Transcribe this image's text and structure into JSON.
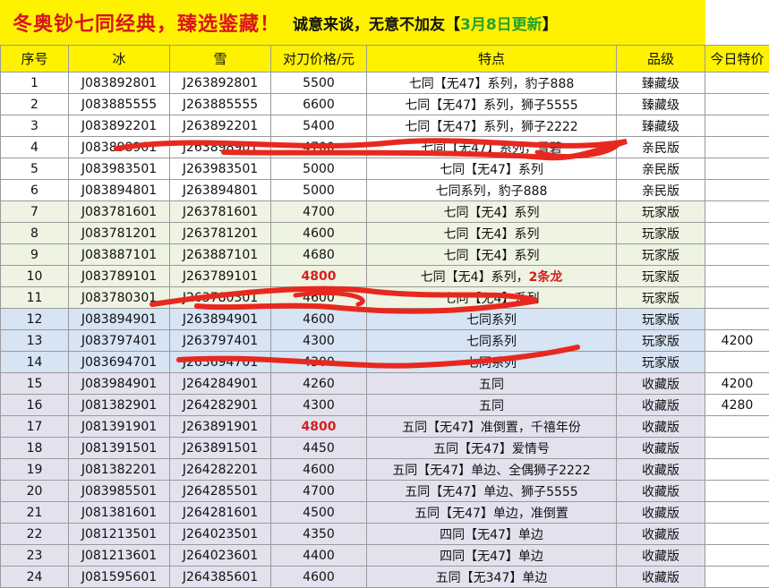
{
  "banner": {
    "title": "冬奥钞七同经典，臻选鉴藏！",
    "subtitle": "诚意来谈，无意不加友",
    "bracket_open": "【",
    "update": "3月8日更新",
    "bracket_close": "】"
  },
  "table": {
    "headers": [
      "序号",
      "冰",
      "雪",
      "对刀价格/元",
      "特点",
      "品级",
      "今日特价"
    ],
    "rows": [
      {
        "no": "1",
        "ice": "J083892801",
        "snow": "J263892801",
        "price": "5500",
        "feature": "七同【无47】系列，豹子888",
        "extra": "",
        "grade": "臻藏级",
        "special": "",
        "bg": "#ffffff"
      },
      {
        "no": "2",
        "ice": "J083885555",
        "snow": "J263885555",
        "price": "6600",
        "feature": "七同【无47】系列，狮子5555",
        "extra": "",
        "grade": "臻藏级",
        "special": "",
        "bg": "#ffffff"
      },
      {
        "no": "3",
        "ice": "J083892201",
        "snow": "J263892201",
        "price": "5400",
        "feature": "七同【无47】系列，狮子2222",
        "extra": "",
        "grade": "臻藏级",
        "special": "",
        "bg": "#ffffff"
      },
      {
        "no": "4",
        "ice": "J083898901",
        "snow": "J263898901",
        "price": "4700",
        "feature": "七同【无47】系列，雪碧",
        "extra": "",
        "grade": "亲民版",
        "special": "",
        "bg": "#ffffff"
      },
      {
        "no": "5",
        "ice": "J083983501",
        "snow": "J263983501",
        "price": "5000",
        "feature": "七同【无47】系列",
        "extra": "",
        "grade": "亲民版",
        "special": "",
        "bg": "#ffffff"
      },
      {
        "no": "6",
        "ice": "J083894801",
        "snow": "J263894801",
        "price": "5000",
        "feature": "七同系列，豹子888",
        "extra": "",
        "grade": "亲民版",
        "special": "",
        "bg": "#ffffff"
      },
      {
        "no": "7",
        "ice": "J083781601",
        "snow": "J263781601",
        "price": "4700",
        "feature": "七同【无4】系列",
        "extra": "",
        "grade": "玩家版",
        "special": "",
        "bg": "#eef3e2"
      },
      {
        "no": "8",
        "ice": "J083781201",
        "snow": "J263781201",
        "price": "4600",
        "feature": "七同【无4】系列",
        "extra": "",
        "grade": "玩家版",
        "special": "",
        "bg": "#eef3e2"
      },
      {
        "no": "9",
        "ice": "J083887101",
        "snow": "J263887101",
        "price": "4680",
        "feature": "七同【无4】系列",
        "extra": "",
        "grade": "玩家版",
        "special": "",
        "bg": "#eef3e2"
      },
      {
        "no": "10",
        "ice": "J083789101",
        "snow": "J263789101",
        "price": "4800",
        "price_red": true,
        "feature": "七同【无4】系列，",
        "extra": "2条龙",
        "grade": "玩家版",
        "special": "",
        "bg": "#eef3e2"
      },
      {
        "no": "11",
        "ice": "J083780301",
        "snow": "J263780301",
        "price": "4600",
        "feature": "七同【无4】系列",
        "extra": "",
        "grade": "玩家版",
        "special": "",
        "bg": "#eef3e2"
      },
      {
        "no": "12",
        "ice": "J083894901",
        "snow": "J263894901",
        "price": "4600",
        "feature": "七同系列",
        "extra": "",
        "grade": "玩家版",
        "special": "",
        "bg": "#d6e4f4"
      },
      {
        "no": "13",
        "ice": "J083797401",
        "snow": "J263797401",
        "price": "4300",
        "feature": "七同系列",
        "extra": "",
        "grade": "玩家版",
        "special": "4200",
        "bg": "#d6e4f4"
      },
      {
        "no": "14",
        "ice": "J083694701",
        "snow": "J263694701",
        "price": "4300",
        "feature": "七同系列",
        "extra": "",
        "grade": "玩家版",
        "special": "",
        "bg": "#d6e4f4"
      },
      {
        "no": "15",
        "ice": "J083984901",
        "snow": "J264284901",
        "price": "4260",
        "feature": "五同",
        "extra": "",
        "grade": "收藏版",
        "special": "4200",
        "bg": "#e4e1ef"
      },
      {
        "no": "16",
        "ice": "J081382901",
        "snow": "J264282901",
        "price": "4300",
        "feature": "五同",
        "extra": "",
        "grade": "收藏版",
        "special": "4280",
        "bg": "#e4e1ef"
      },
      {
        "no": "17",
        "ice": "J081391901",
        "snow": "J263891901",
        "price": "4800",
        "price_red": true,
        "feature": "五同【无47】准倒置，千禧年份",
        "extra": "",
        "grade": "收藏版",
        "special": "",
        "bg": "#e4e1ef"
      },
      {
        "no": "18",
        "ice": "J081391501",
        "snow": "J263891501",
        "price": "4450",
        "feature": "五同【无47】爱情号",
        "extra": "",
        "grade": "收藏版",
        "special": "",
        "bg": "#e4e1ef"
      },
      {
        "no": "19",
        "ice": "J081382201",
        "snow": "J264282201",
        "price": "4600",
        "feature": "五同【无47】单边、全偶狮子2222",
        "extra": "",
        "grade": "收藏版",
        "special": "",
        "bg": "#e4e1ef"
      },
      {
        "no": "20",
        "ice": "J083985501",
        "snow": "J264285501",
        "price": "4700",
        "feature": "五同【无47】单边、狮子5555",
        "extra": "",
        "grade": "收藏版",
        "special": "",
        "bg": "#e4e1ef"
      },
      {
        "no": "21",
        "ice": "J081381601",
        "snow": "J264281601",
        "price": "4500",
        "feature": "五同【无47】单边，准倒置",
        "extra": "",
        "grade": "收藏版",
        "special": "",
        "bg": "#e4e1ef"
      },
      {
        "no": "22",
        "ice": "J081213501",
        "snow": "J264023501",
        "price": "4350",
        "feature": "四同【无47】单边",
        "extra": "",
        "grade": "收藏版",
        "special": "",
        "bg": "#e4e1ef"
      },
      {
        "no": "23",
        "ice": "J081213601",
        "snow": "J264023601",
        "price": "4400",
        "feature": "四同【无47】单边",
        "extra": "",
        "grade": "收藏版",
        "special": "",
        "bg": "#e4e1ef"
      },
      {
        "no": "24",
        "ice": "J081595601",
        "snow": "J264385601",
        "price": "4600",
        "feature": "五同【无347】单边",
        "extra": "",
        "grade": "收藏版",
        "special": "",
        "bg": "#e4e1ef"
      }
    ]
  },
  "colors": {
    "banner_bg": "#fff200",
    "title_red": "#d8141b",
    "update_green": "#2aa12a",
    "scribble_red": "#e8281e"
  }
}
